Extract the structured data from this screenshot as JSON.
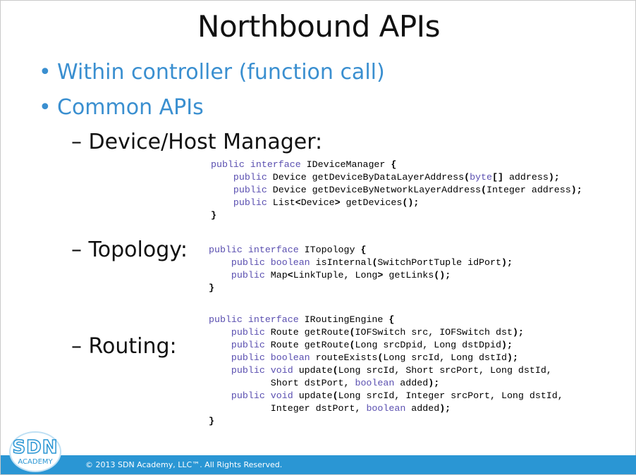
{
  "slide": {
    "title": "Northbound APIs",
    "bullets": [
      "Within controller (function call)",
      "Common APIs"
    ],
    "bullet_marker": "•",
    "subitems": [
      "– Device/Host Manager:",
      "– Topology:",
      "– Routing:"
    ]
  },
  "code": {
    "device_manager": [
      "public interface IDeviceManager {",
      "    public Device getDeviceByDataLayerAddress(byte[] address);",
      "    public Device getDeviceByNetworkLayerAddress(Integer address);",
      "    public List<Device> getDevices();",
      "}"
    ],
    "topology": [
      "public interface ITopology {",
      "    public boolean isInternal(SwitchPortTuple idPort);",
      "    public Map<LinkTuple, Long> getLinks();",
      "}"
    ],
    "routing": [
      "public interface IRoutingEngine {",
      "    public Route getRoute(IOFSwitch src, IOFSwitch dst);",
      "    public Route getRoute(Long srcDpid, Long dstDpid);",
      "    public boolean routeExists(Long srcId, Long dstId);",
      "    public void update(Long srcId, Short srcPort, Long dstId,",
      "           Short dstPort, boolean added);",
      "    public void update(Long srcId, Integer srcPort, Long dstId,",
      "           Integer dstPort, boolean added);",
      "}"
    ]
  },
  "footer": {
    "copyright": "© 2013 SDN Academy, LLC™. All Rights Reserved.",
    "logo_main": "SDN",
    "logo_sub": "ACADEMY"
  },
  "colors": {
    "accent": "#3a8fd0",
    "footer_bar": "#2a96d4",
    "keyword": "#5a4fb0"
  }
}
